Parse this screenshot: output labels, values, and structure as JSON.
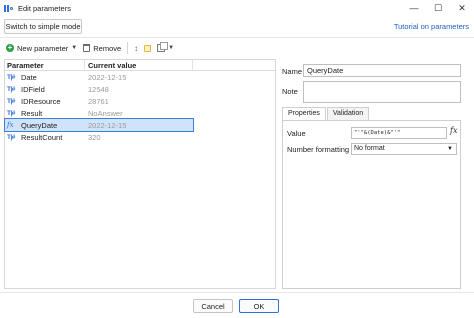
{
  "window": {
    "title": "Edit parameters",
    "controls": {
      "minimize": "—",
      "maximize": "☐",
      "close": "✕"
    }
  },
  "mode_bar": {
    "simple_mode_label": "Switch to simple mode",
    "tutorial_label": "Tutorial on parameters"
  },
  "toolbar": {
    "new_parameter_label": "New parameter",
    "remove_label": "Remove",
    "icons": [
      "plus-icon",
      "trash-icon",
      "sort-icon",
      "lock-icon",
      "copy-icon"
    ]
  },
  "grid": {
    "headers": {
      "parameter": "Parameter",
      "current_value": "Current value"
    },
    "rows": [
      {
        "icon": "T|#",
        "name": "Date",
        "value": "2022-12-15",
        "selected": false
      },
      {
        "icon": "T|#",
        "name": "IDField",
        "value": "12548",
        "selected": false
      },
      {
        "icon": "T|#",
        "name": "IDResource",
        "value": "28761",
        "selected": false
      },
      {
        "icon": "T|#",
        "name": "Result",
        "value": "NoAnswer",
        "selected": false
      },
      {
        "icon": "fx",
        "name": "QueryDate",
        "value": "2022-12-15",
        "selected": true
      },
      {
        "icon": "T|#",
        "name": "ResultCount",
        "value": "320",
        "selected": false
      }
    ]
  },
  "details": {
    "name_label": "Name",
    "name_value": "QueryDate",
    "note_label": "Note",
    "note_value": "",
    "tabs": [
      {
        "label": "Properties",
        "active": true
      },
      {
        "label": "Validation",
        "active": false
      }
    ],
    "value_label": "Value",
    "value_expression": "\"'\"&(Date)&\"'\"",
    "fx_label": "fx",
    "number_formatting_label": "Number formatting",
    "number_formatting_value": "No format"
  },
  "dialog": {
    "cancel_label": "Cancel",
    "ok_label": "OK"
  },
  "colors": {
    "accent": "#2f6fd6",
    "selection": "#cfe3fb",
    "link": "#1f5fc4",
    "add": "#2e9e44"
  }
}
